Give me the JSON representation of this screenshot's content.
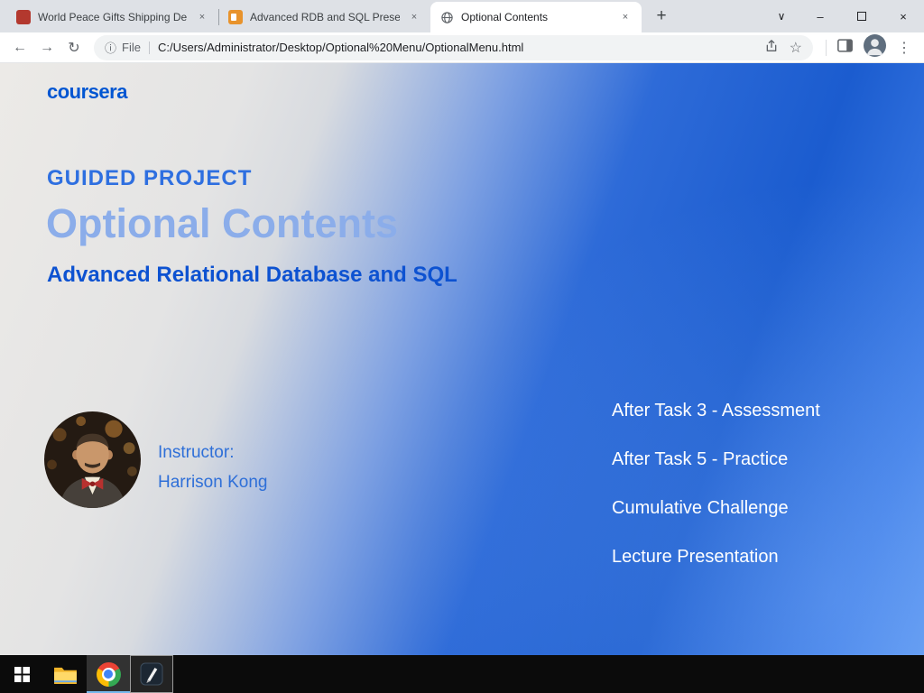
{
  "browser": {
    "tabs": [
      {
        "title": "World Peace Gifts Shipping Depa",
        "favicon": "gift-red-icon"
      },
      {
        "title": "Advanced RDB and SQL Presenta",
        "favicon": "slides-orange-icon"
      },
      {
        "title": "Optional Contents",
        "favicon": "globe-icon",
        "active": true
      }
    ],
    "address": {
      "scheme_label": "File",
      "url": "C:/Users/Administrator/Desktop/Optional%20Menu/OptionalMenu.html"
    }
  },
  "page": {
    "logo_text": "coursera",
    "eyebrow": "GUIDED PROJECT",
    "title": "Optional Contents",
    "subtitle": "Advanced Relational Database and SQL",
    "instructor_label": "Instructor:",
    "instructor_name": "Harrison Kong",
    "menu": [
      "After Task 3 - Assessment",
      "After Task 5 - Practice",
      "Cumulative Challenge",
      "Lecture Presentation"
    ]
  },
  "icons": {
    "back": "←",
    "forward": "→",
    "reload": "↻",
    "info": "ⓘ",
    "star": "☆",
    "overflow": "⋮",
    "tab_close": "×",
    "new_tab": "+",
    "tab_search_chevron": "∨",
    "minimize": "–",
    "close": "×"
  },
  "colors": {
    "coursera_blue": "#0056d2",
    "eyebrow_blue": "#2e6fe0",
    "title_blue": "#8badea",
    "subtitle_blue": "#0d52d1",
    "instructor_blue": "#2e6fd8",
    "menu_white": "#ffffff",
    "tabbar_gray": "#dee1e6",
    "taskbar_black": "#0b0b0b"
  }
}
